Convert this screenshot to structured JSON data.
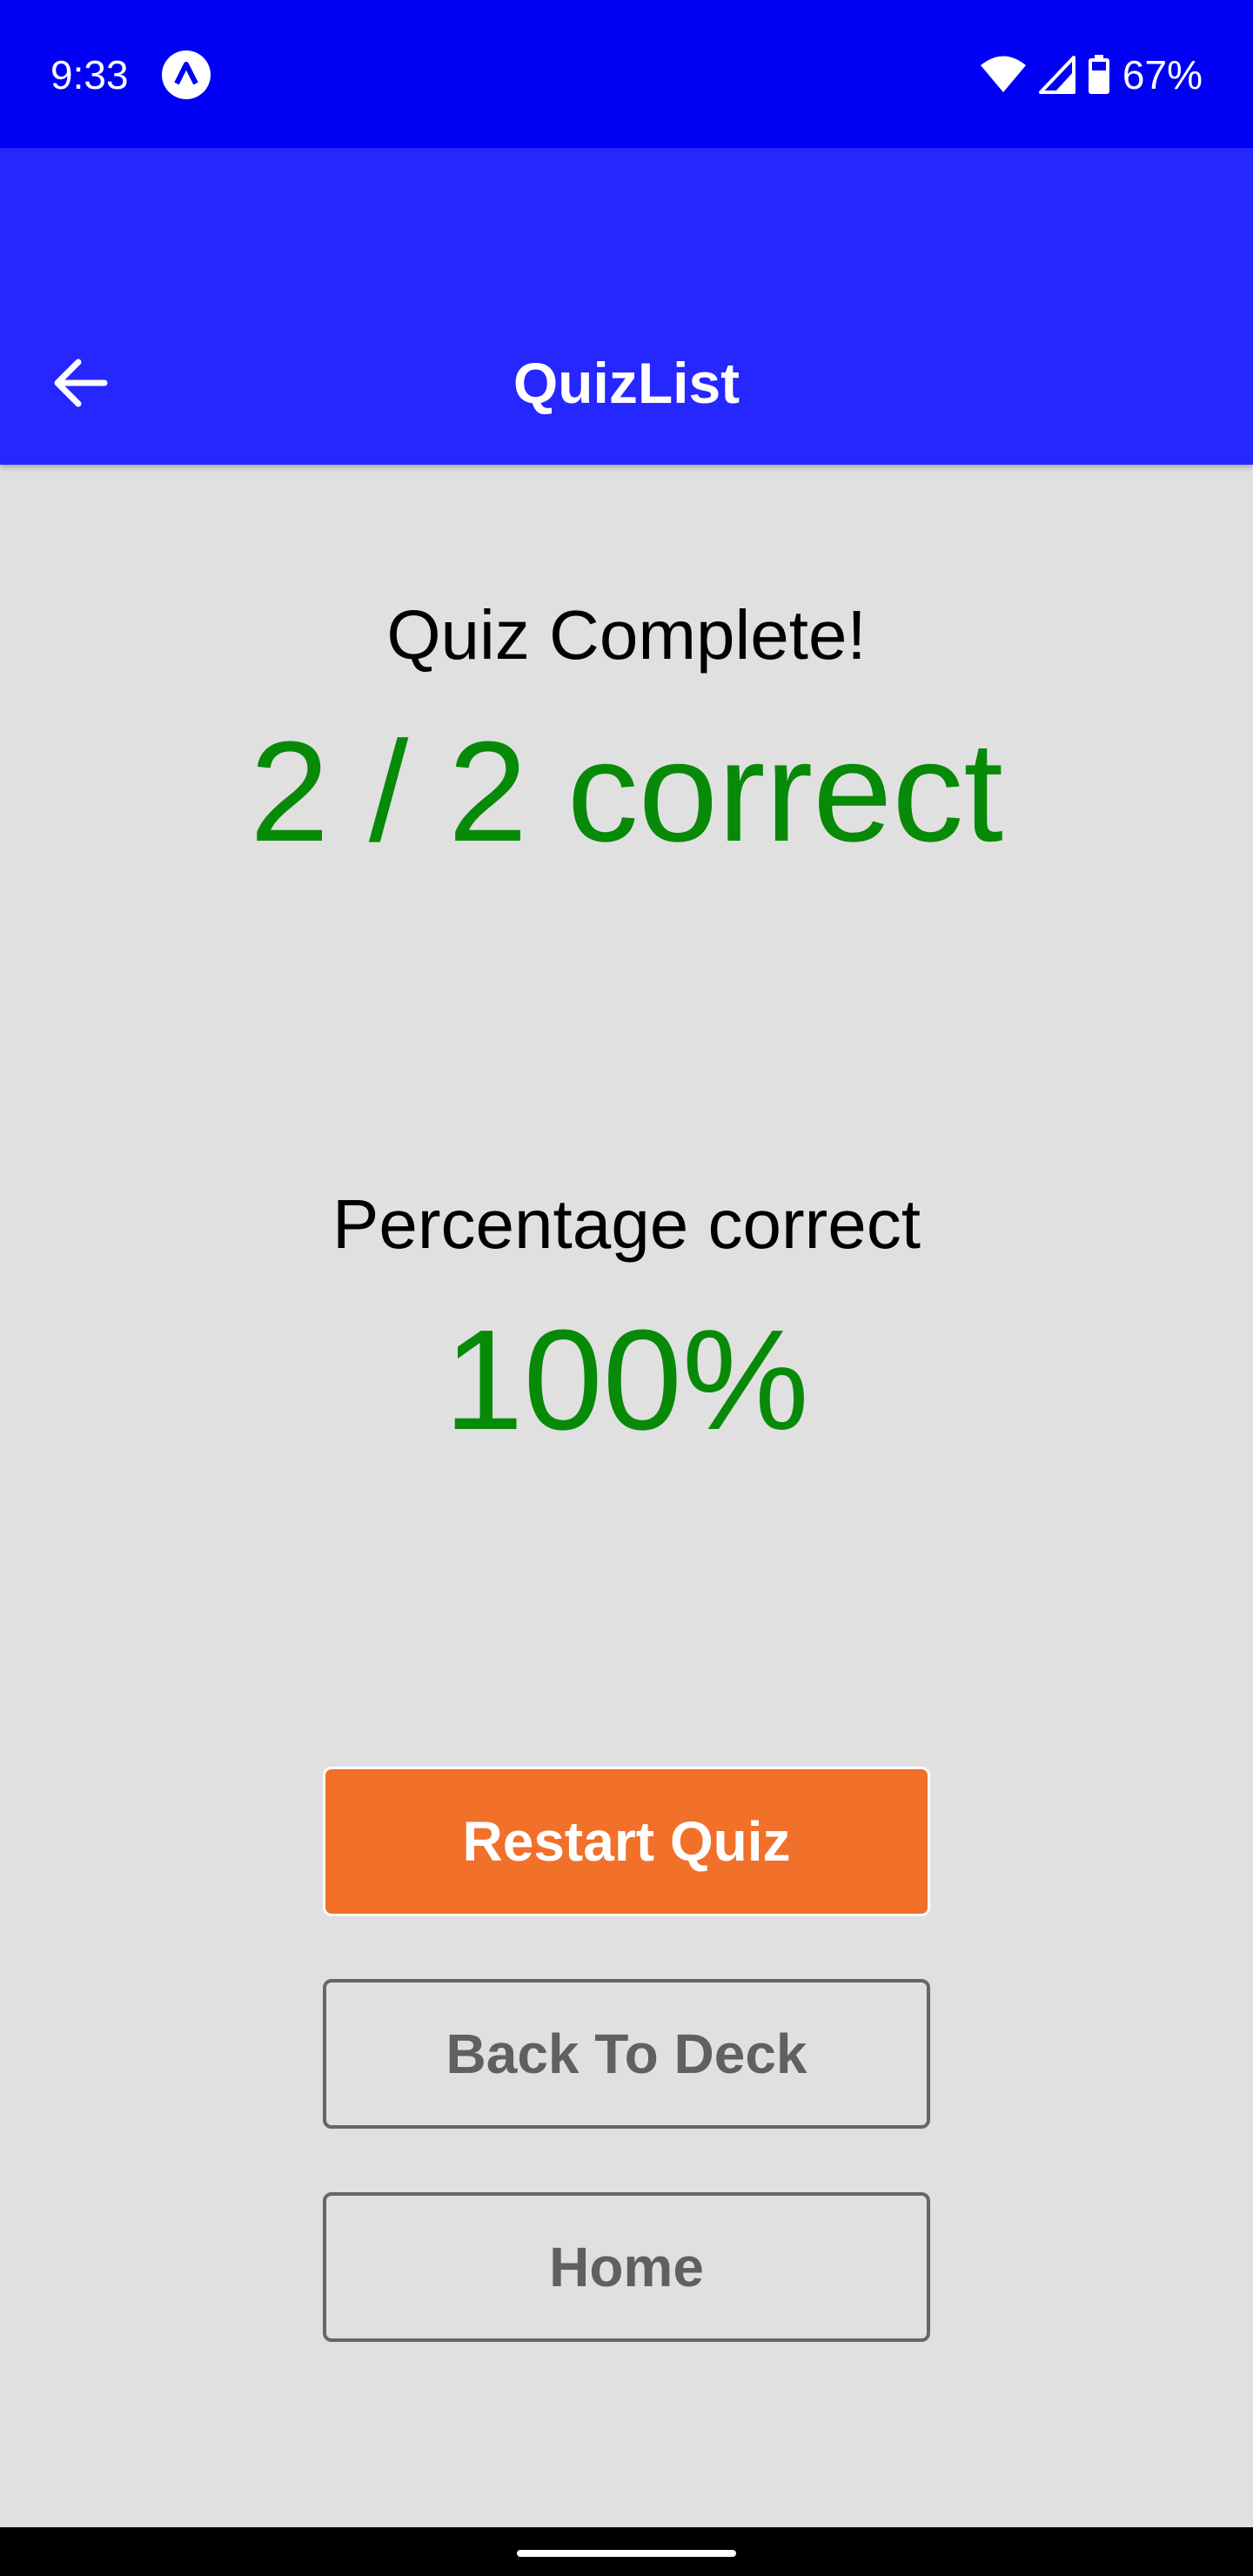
{
  "status_bar": {
    "time": "9:33",
    "battery": "67%",
    "icons": [
      "app-notification-icon",
      "wifi-icon",
      "cell-signal-icon",
      "battery-icon"
    ]
  },
  "app_bar": {
    "title": "QuizList",
    "back_icon": "arrow-left-icon"
  },
  "results": {
    "complete_label": "Quiz Complete!",
    "score": "2 / 2 correct",
    "percentage_label": "Percentage correct",
    "percentage_value": "100%"
  },
  "actions": {
    "restart_label": "Restart Quiz",
    "back_to_deck_label": "Back To Deck",
    "home_label": "Home"
  },
  "colors": {
    "status_bar": "#0000f5",
    "app_bar": "#2626ff",
    "background": "#e0e0e0",
    "score_green": "#078a07",
    "primary_button": "#f1702a",
    "outline_text": "#606060"
  }
}
